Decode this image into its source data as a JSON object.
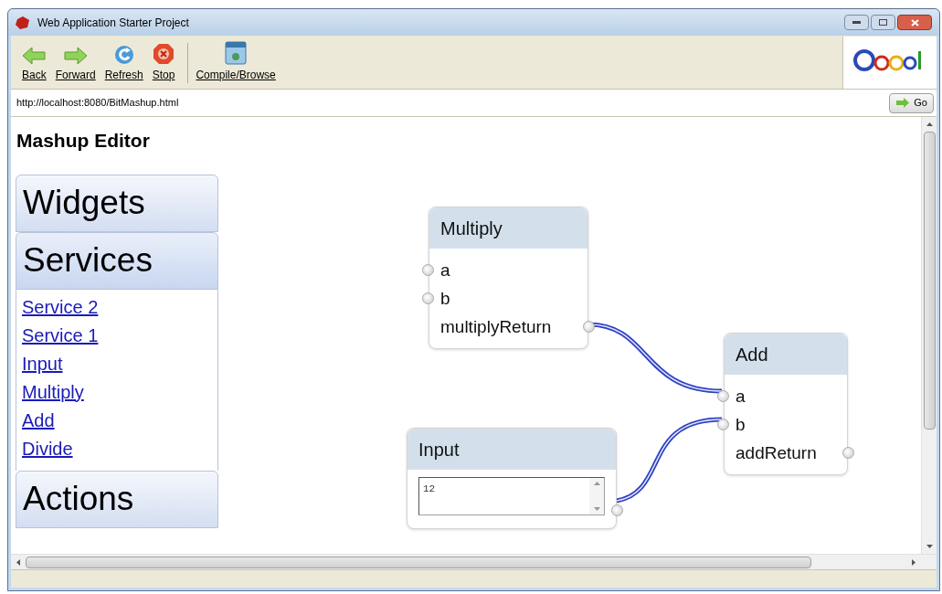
{
  "window": {
    "title": "Web Application Starter Project"
  },
  "toolbar": [
    {
      "label": "Back",
      "kind": "back"
    },
    {
      "label": "Forward",
      "kind": "forward"
    },
    {
      "label": "Refresh",
      "kind": "refresh"
    },
    {
      "label": "Stop",
      "kind": "stop"
    },
    {
      "label": "Compile/Browse",
      "kind": "compile"
    }
  ],
  "address_bar": {
    "value": "http://localhost:8080/BitMashup.html",
    "go_button": "Go"
  },
  "page": {
    "title": "Mashup Editor",
    "accordion": [
      {
        "title": "Widgets",
        "expanded": false
      },
      {
        "title": "Services",
        "expanded": true,
        "items": [
          "Service 2",
          "Service 1",
          "Input",
          "Multiply",
          "Add",
          "Divide"
        ]
      },
      {
        "title": "Actions",
        "expanded": false
      }
    ],
    "nodes": [
      {
        "title": "Multiply",
        "kind": "function",
        "ports": [
          {
            "name": "a",
            "kind": "input"
          },
          {
            "name": "b",
            "kind": "input"
          },
          {
            "name": "multiplyReturn",
            "kind": "output"
          }
        ]
      },
      {
        "title": "Add",
        "kind": "function",
        "ports": [
          {
            "name": "a",
            "kind": "input"
          },
          {
            "name": "b",
            "kind": "input"
          },
          {
            "name": "addReturn",
            "kind": "output"
          }
        ]
      },
      {
        "title": "Input",
        "kind": "input",
        "value": "12"
      }
    ]
  }
}
